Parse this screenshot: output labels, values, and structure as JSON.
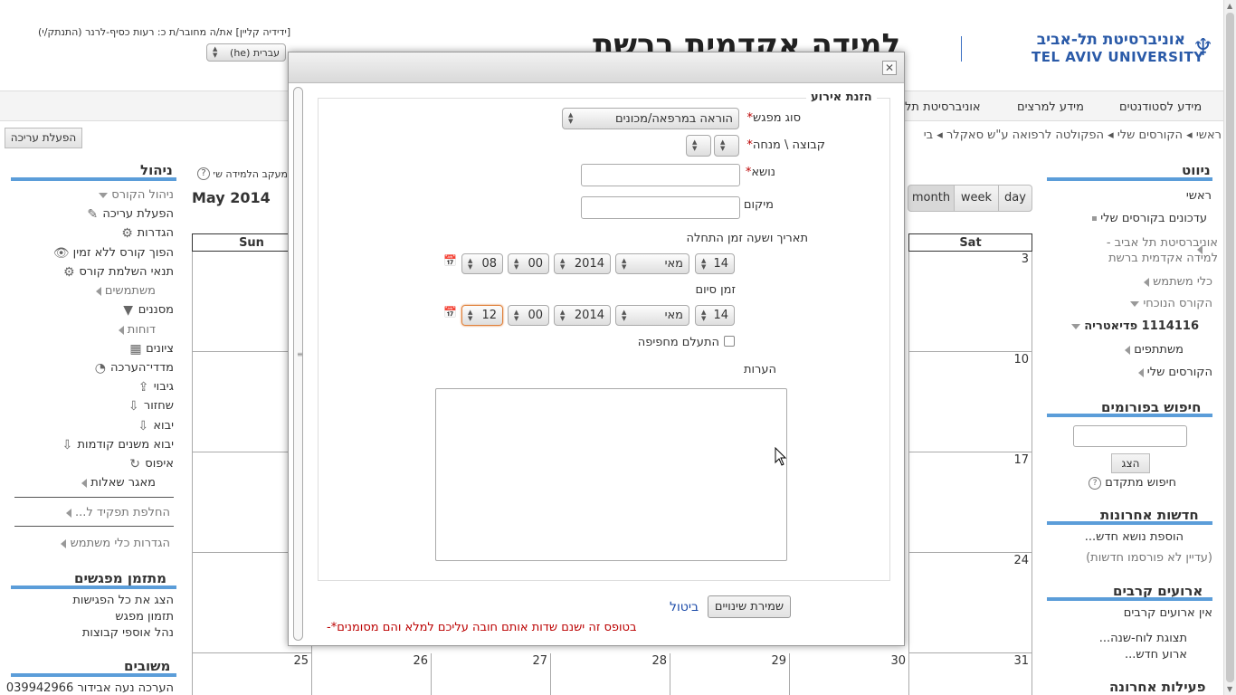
{
  "header": {
    "user_line": "[ידידיה קליין] את/ה מחובר/ת כ: רעות כסיף-לרנר (התנתק/י)",
    "language": "עברית (he)",
    "site_title": "למידה אקדמית ברשת",
    "logo_he": "אוניברסיטת תל-אביב",
    "logo_en": "TEL AVIV UNIVERSITY"
  },
  "topmenu": [
    "מידע לסטודנטים",
    "מידע למרצים",
    "אוניברסיטת תל"
  ],
  "breadcrumb": [
    "ראשי",
    "הקורסים שלי",
    "הפקולטה לרפואה ע\"ש סאקלר",
    "בי"
  ],
  "edit_button": "הפעלת עריכה",
  "left": {
    "manage_title": "ניהול",
    "items": [
      "ניהול הקורס",
      "הפעלת עריכה",
      "הגדרות",
      "הפוך קורס ללא זמין",
      "תנאי השלמת קורס",
      "משתמשים",
      "מסננים",
      "דוחות",
      "ציונים",
      "מדדי־הערכה",
      "גיבוי",
      "שחזור",
      "יבוא",
      "יבוא משנים קודמות",
      "איפוס",
      "מאגר שאלות"
    ],
    "switch_role": "החלפת תפקיד ל...",
    "user_settings": "הגדרות כלי משתמש",
    "scheduler_title": "מתזמן מפגשים",
    "scheduler_items": [
      "הצג את כל הפגישות",
      "תזמון מפגש",
      "נהל אוספי קבוצות"
    ],
    "feedback_title": "משובים",
    "feedback_item": "הערכה נעה אבידור 039942966"
  },
  "calendar": {
    "title": "May 2014",
    "help_text": "מעקב הלמידה שלך",
    "views": [
      "month",
      "week",
      "day"
    ],
    "headers": [
      "Sun",
      "Sat"
    ],
    "sat_days": [
      "3",
      "10",
      "17",
      "24",
      "31"
    ],
    "last_row": [
      "25",
      "26",
      "27",
      "28",
      "29",
      "30",
      "31"
    ]
  },
  "right": {
    "nav_title": "ניווט",
    "nav_items": [
      "ראשי",
      "עדכונים בקורסים שלי",
      "אוניברסיטת תל אביב - למידה אקדמית ברשת",
      "כלי משתמש",
      "הקורס הנוכחי",
      "1114116 פדיאטריה",
      "משתתפים",
      "הקורסים שלי"
    ],
    "forum_title": "חיפוש בפורומים",
    "search_btn": "הצג",
    "adv_search": "חיפוש מתקדם",
    "news_title": "חדשות אחרונות",
    "news_add": "הוספת נושא חדש...",
    "news_none": "(עדיין לא פורסמו חדשות)",
    "events_title": "ארועים קרבים",
    "events_none": "אין ארועים קרבים",
    "events_cal": "תצוגת לוח-שנה...",
    "events_new": "ארוע חדש...",
    "activity_title": "פעילות אחרונה"
  },
  "dialog": {
    "legend": "הזנת אירוע",
    "type_label": "סוג מפגש",
    "type_value": "הוראה במרפאה/מכונים",
    "group_label": "קבוצה \\ מנחה",
    "subject_label": "נושא",
    "location_label": "מיקום",
    "date_label": "תאריך ושעה  זמן התחלה",
    "start": {
      "day": "14",
      "month": "מאי",
      "year": "2014",
      "min": "00",
      "hour": "08"
    },
    "end_label": "זמן סיום",
    "end": {
      "day": "14",
      "month": "מאי",
      "year": "2014",
      "min": "00",
      "hour": "12"
    },
    "overlap_label": "התעלם מחפיפה",
    "notes_label": "הערות",
    "save": "שמירת שינויים",
    "cancel": "ביטול",
    "required_note": "בטופס זה ישנם שדות אותם חובה עליכם למלא והם מסומנים"
  }
}
